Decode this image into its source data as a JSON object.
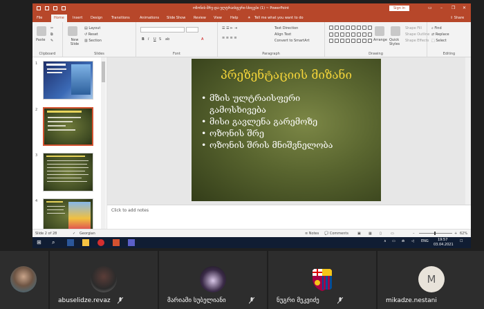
{
  "powerpoint": {
    "title": "ოზონის-შრე-და-ულტრაისფერი-სხივები (1)  ~  PowerPoint",
    "search": "Tell me what you want to do",
    "sign_in": "Sign in",
    "share": "Share",
    "tabs": [
      "File",
      "Home",
      "Insert",
      "Design",
      "Transitions",
      "Animations",
      "Slide Show",
      "Review",
      "View",
      "Help"
    ],
    "active_tab": "Home",
    "ribbon": {
      "clipboard": "Clipboard",
      "paste": "Paste",
      "slides": "Slides",
      "new_slide": "New Slide",
      "layout": "Layout",
      "reset": "Reset",
      "section": "Section",
      "font": "Font",
      "paragraph": "Paragraph",
      "text_direction": "Text Direction",
      "align_text": "Align Text",
      "convert_smartart": "Convert to SmartArt",
      "drawing": "Drawing",
      "arrange": "Arrange",
      "quick_styles": "Quick Styles",
      "shape_fill": "Shape Fill",
      "shape_outline": "Shape Outline",
      "shape_effects": "Shape Effects",
      "editing": "Editing",
      "find": "Find",
      "replace": "Replace",
      "select": "Select"
    },
    "thumbnails": [
      "1",
      "2",
      "3",
      "4"
    ],
    "slide": {
      "title": "პრეზენტაციის მიზანი",
      "bullets": [
        "მზის ულტრაისფერი გამოსხივება",
        "მისი გავლენა გარემოზე",
        "ოზონის შრე",
        "ოზონის შრის მნიშვნელობა"
      ]
    },
    "notes_placeholder": "Click to add notes",
    "status": {
      "slide_counter": "Slide 2 of 28",
      "language": "Georgian",
      "notes": "Notes",
      "comments": "Comments",
      "zoom": "62%"
    },
    "taskbar": {
      "lang": "ENG",
      "time": "19:57",
      "date": "03.04.2021"
    }
  },
  "participants": [
    {
      "name": "",
      "avatar": "photo-woman"
    },
    {
      "name": "abuselidze.revaz",
      "avatar": "photo-person"
    },
    {
      "name": "მარიამი სუბელიანი",
      "avatar": "photo-cat"
    },
    {
      "name": "ნუგრი მეკვიძე",
      "avatar": "fcb-logo"
    },
    {
      "name": "mikadze.nestani",
      "avatar": "M"
    }
  ],
  "colors": {
    "ppt_accent": "#b7472a",
    "slide_title": "#f2d33a",
    "taskbar": "#101d33",
    "tile_bg": "#2d2d2d"
  }
}
